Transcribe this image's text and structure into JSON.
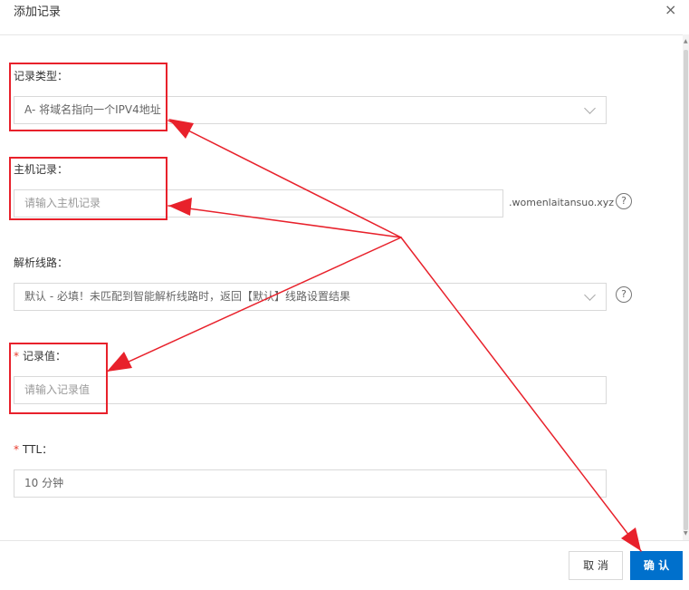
{
  "dialog": {
    "title": "添加记录",
    "close_icon": "×"
  },
  "form": {
    "record_type": {
      "label": "记录类型：",
      "value": "A- 将域名指向一个IPV4地址"
    },
    "host_record": {
      "label": "主机记录：",
      "placeholder": "请输入主机记录",
      "suffix": ".womenlaitansuo.xyz"
    },
    "line": {
      "label": "解析线路：",
      "value": "默认 - 必填！未匹配到智能解析线路时，返回【默认】线路设置结果"
    },
    "record_value": {
      "required_mark": "*",
      "label": "记录值：",
      "placeholder": "请输入记录值"
    },
    "ttl": {
      "required_mark": "*",
      "label": "TTL：",
      "value": "10 分钟"
    }
  },
  "help_icon": "?",
  "footer": {
    "cancel_label": "取 消",
    "confirm_label": "确 认"
  },
  "colors": {
    "annotation_red": "#e8212b",
    "primary_blue": "#0070cc",
    "required_red": "#e8392b"
  }
}
